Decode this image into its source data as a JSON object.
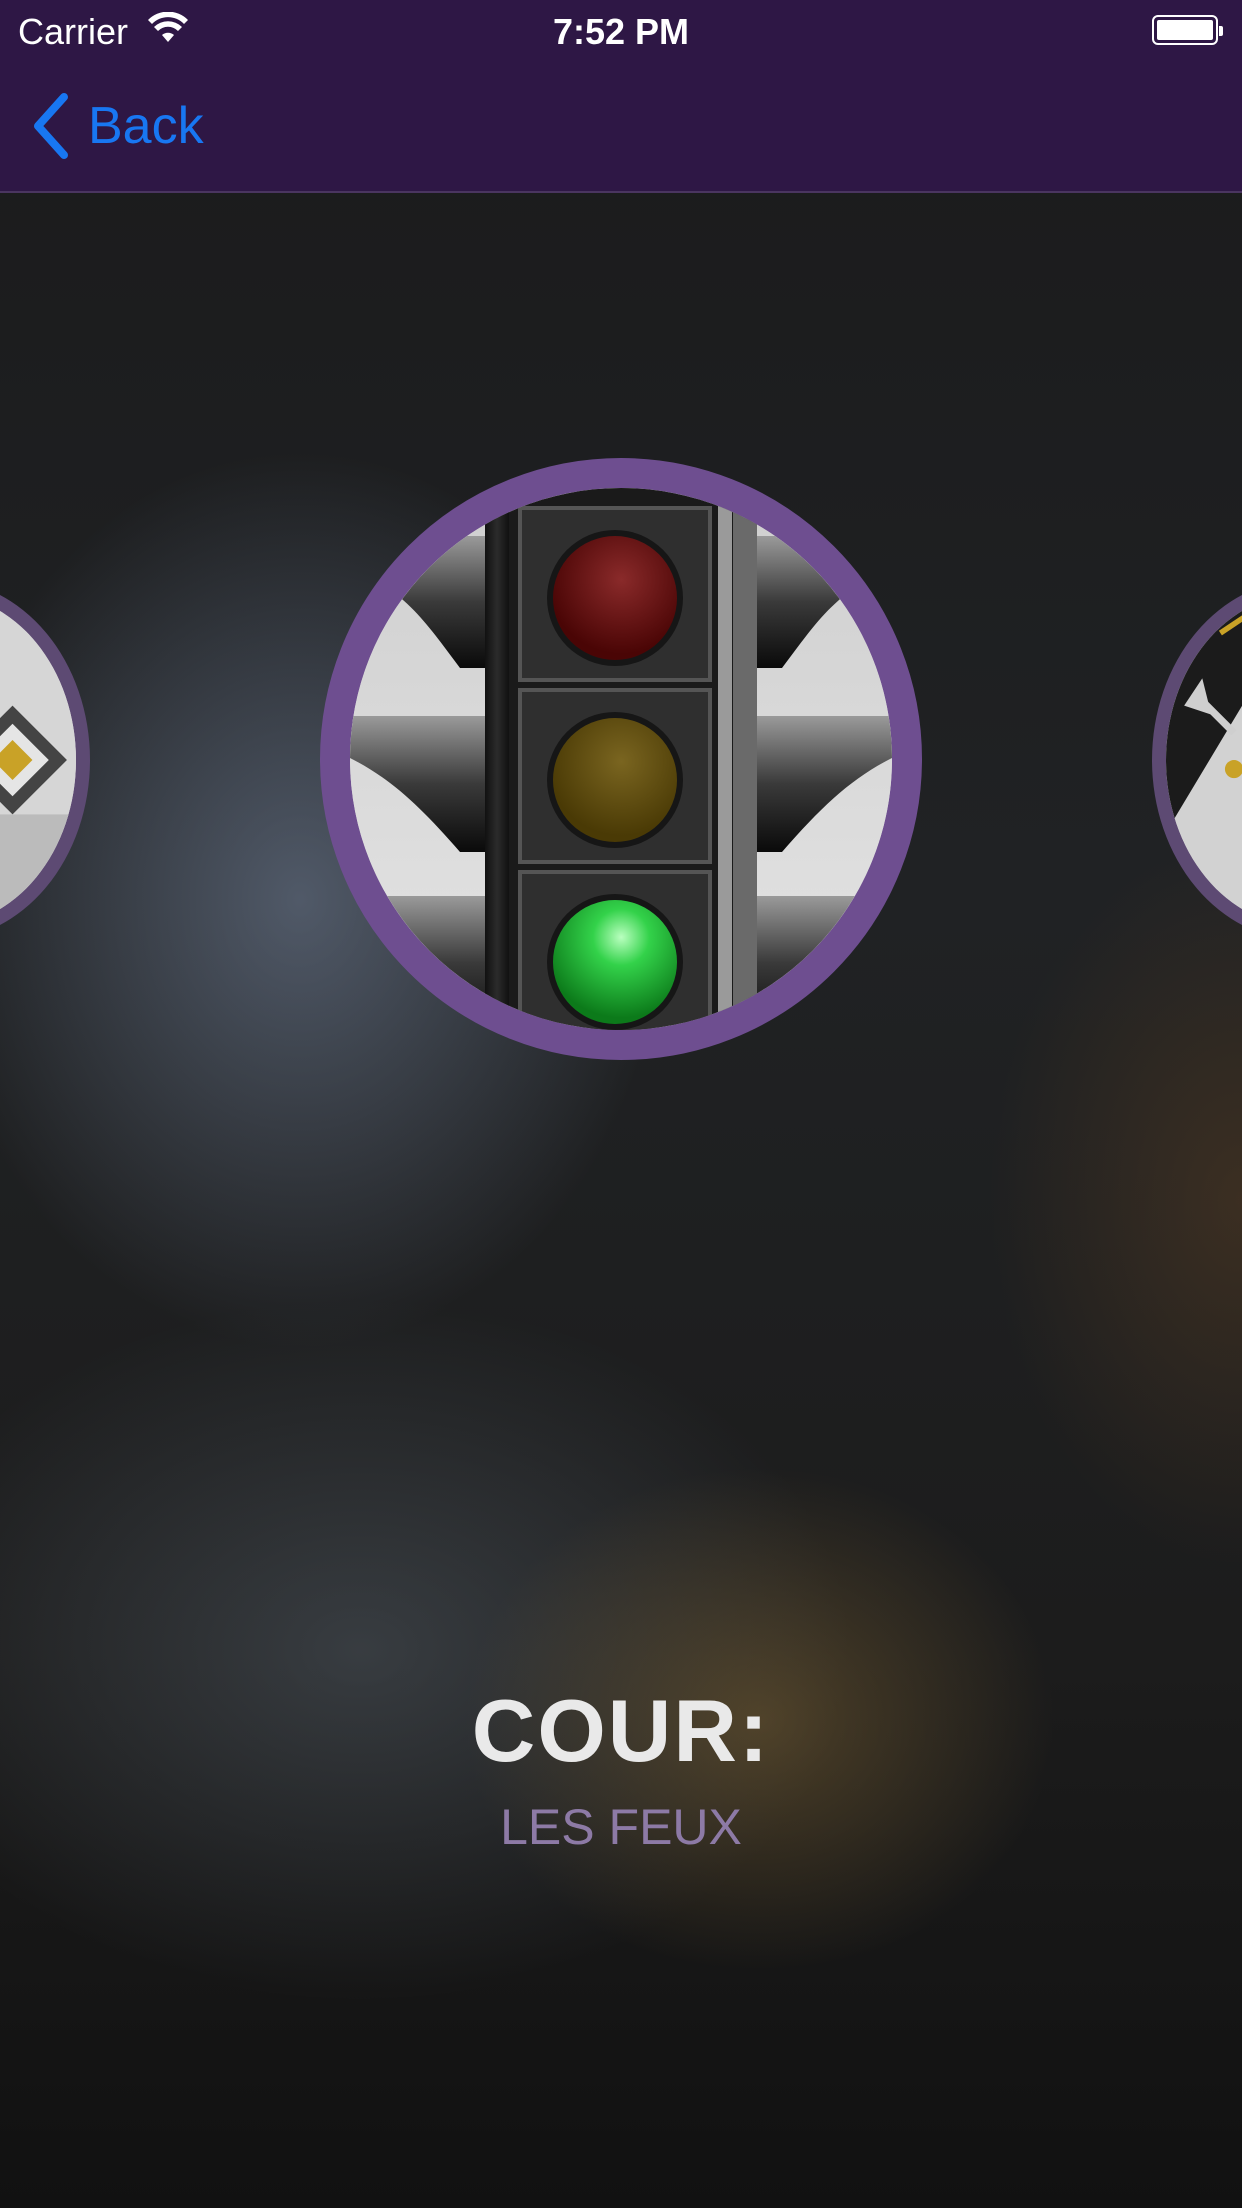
{
  "status_bar": {
    "carrier": "Carrier",
    "time": "7:52 PM"
  },
  "nav": {
    "back_label": "Back"
  },
  "lesson": {
    "title": "COUR:",
    "subtitle": "LES FEUX"
  },
  "colors": {
    "nav_background": "#2e1745",
    "accent_ring": "#6e4e90",
    "back_text": "#1877f2",
    "subtitle_text": "#8d7aa6"
  },
  "icons": {
    "main_card": "traffic-light-icon",
    "left_card": "yield-sign-icon",
    "right_card": "road-arrow-icon"
  }
}
